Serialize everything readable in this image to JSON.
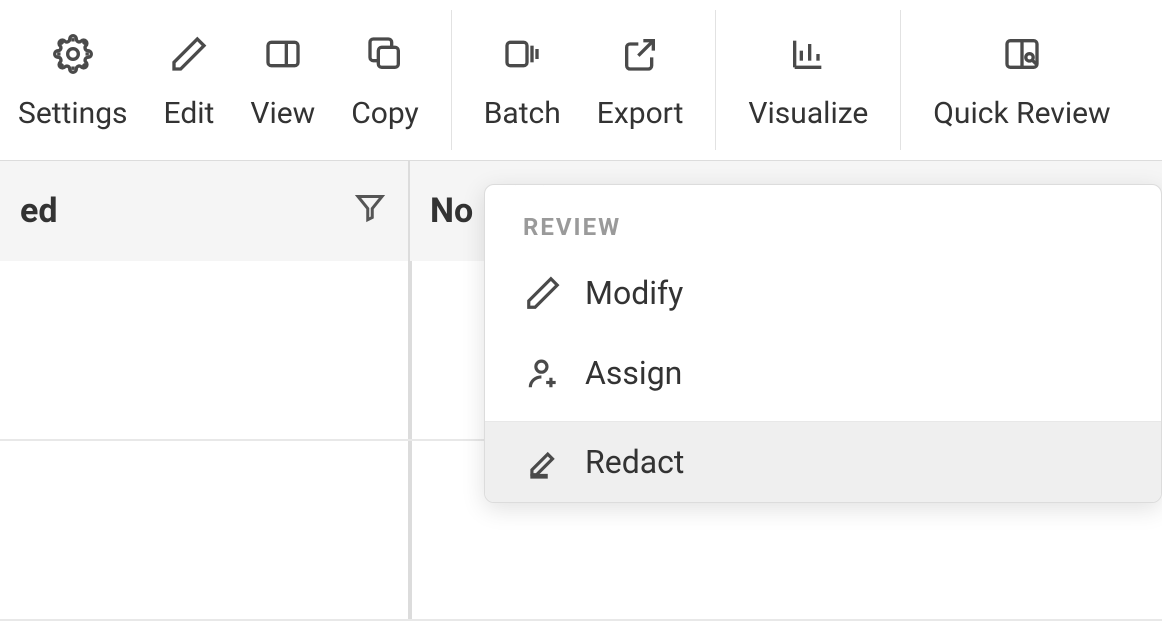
{
  "toolbar": {
    "items": [
      {
        "label": "Settings",
        "icon": "gear"
      },
      {
        "label": "Edit",
        "icon": "pencil"
      },
      {
        "label": "View",
        "icon": "panel"
      },
      {
        "label": "Copy",
        "icon": "copy"
      }
    ],
    "group2": [
      {
        "label": "Batch",
        "icon": "batch"
      },
      {
        "label": "Export",
        "icon": "export"
      }
    ],
    "group3": [
      {
        "label": "Visualize",
        "icon": "chart"
      }
    ],
    "group4": [
      {
        "label": "Quick Review",
        "icon": "quickreview"
      }
    ]
  },
  "table": {
    "col1_header": "ed",
    "col2_header": "No"
  },
  "dropdown": {
    "section_label": "REVIEW",
    "items": [
      {
        "label": "Modify",
        "icon": "pencil",
        "highlight": false
      },
      {
        "label": "Assign",
        "icon": "assign",
        "highlight": false
      },
      {
        "label": "Redact",
        "icon": "redact",
        "highlight": true
      }
    ]
  }
}
